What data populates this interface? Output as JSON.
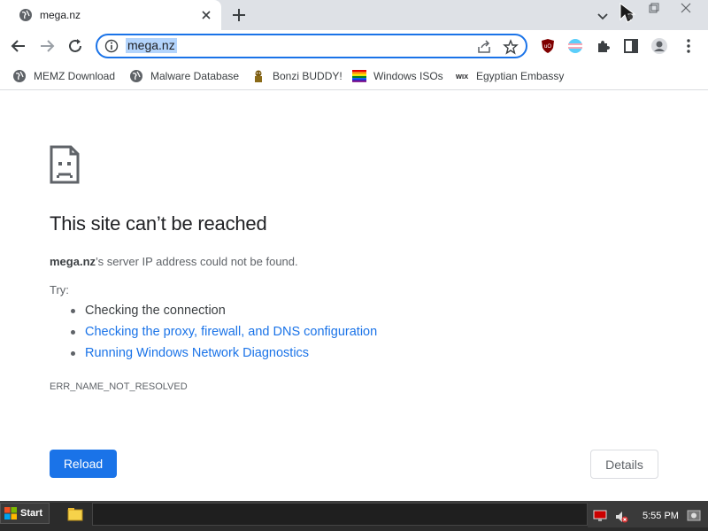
{
  "tab": {
    "title": "mega.nz"
  },
  "omnibox": {
    "url": "mega.nz"
  },
  "bookmarks": [
    {
      "label": "MEMZ Download",
      "icon": "globe-icon"
    },
    {
      "label": "Malware Database",
      "icon": "globe-icon"
    },
    {
      "label": "Bonzi BUDDY!",
      "icon": "bonzi-icon"
    },
    {
      "label": "Windows ISOs",
      "icon": "windows-icon"
    },
    {
      "label": "Egyptian Embassy",
      "icon": "wix-icon"
    }
  ],
  "page": {
    "title": "This site can’t be reached",
    "summary_domain": "mega.nz",
    "summary_rest": "’s server IP address could not be found.",
    "try_label": "Try:",
    "suggestions": [
      "Checking the connection",
      "Checking the proxy, firewall, and DNS configuration",
      "Running Windows Network Diagnostics"
    ],
    "error_code": "ERR_NAME_NOT_RESOLVED",
    "reload_label": "Reload",
    "details_label": "Details"
  },
  "taskbar": {
    "start_label": "Start",
    "clock": "5:55 PM"
  },
  "colors": {
    "accent": "#1a73e8",
    "tabstrip": "#dee1e6",
    "taskbar": "#2b2b2b"
  }
}
